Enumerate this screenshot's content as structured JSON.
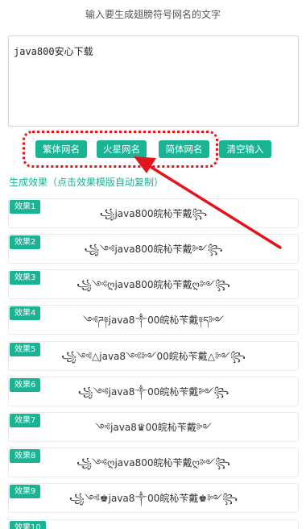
{
  "header": {
    "title": "输入要生成翅膀符号网名的文字"
  },
  "input": {
    "value": "java800安心下载"
  },
  "buttons": [
    {
      "label": "繁体网名"
    },
    {
      "label": "火星网名"
    },
    {
      "label": "简体网名"
    },
    {
      "label": "清空输入"
    }
  ],
  "results_heading": "生成效果（点击效果模版自动复制）",
  "results": [
    {
      "tag": "效果1",
      "text": "꧁java800皖杺苄戴꧂"
    },
    {
      "tag": "效果2",
      "text": "꧁༺java800皖杺苄戴༻꧂"
    },
    {
      "tag": "效果3",
      "text": "꧁༺ღjava800皖杺苄戴ღ༻꧂"
    },
    {
      "tag": "效果4",
      "text": "༺ཌ༈java8༒00皖杺苄戴༈ད༻"
    },
    {
      "tag": "效果5",
      "text": "꧁༺△java8༺༻00皖杺苄戴△༻꧂"
    },
    {
      "tag": "效果6",
      "text": "꧁༺java8༒00皖杺苄戴༻꧂"
    },
    {
      "tag": "效果7",
      "text": "༺java8♛00皖杺苄戴༻"
    },
    {
      "tag": "效果8",
      "text": "꧁༺ღjava800皖杺苄戴ღ༻꧂"
    },
    {
      "tag": "效果9",
      "text": "꧁༺♚java8༒00皖杺苄戴♚༻꧂"
    },
    {
      "tag": "效果10",
      "text": ""
    }
  ],
  "accent_color": "#1ab394",
  "annotation_color": "#e4141d"
}
